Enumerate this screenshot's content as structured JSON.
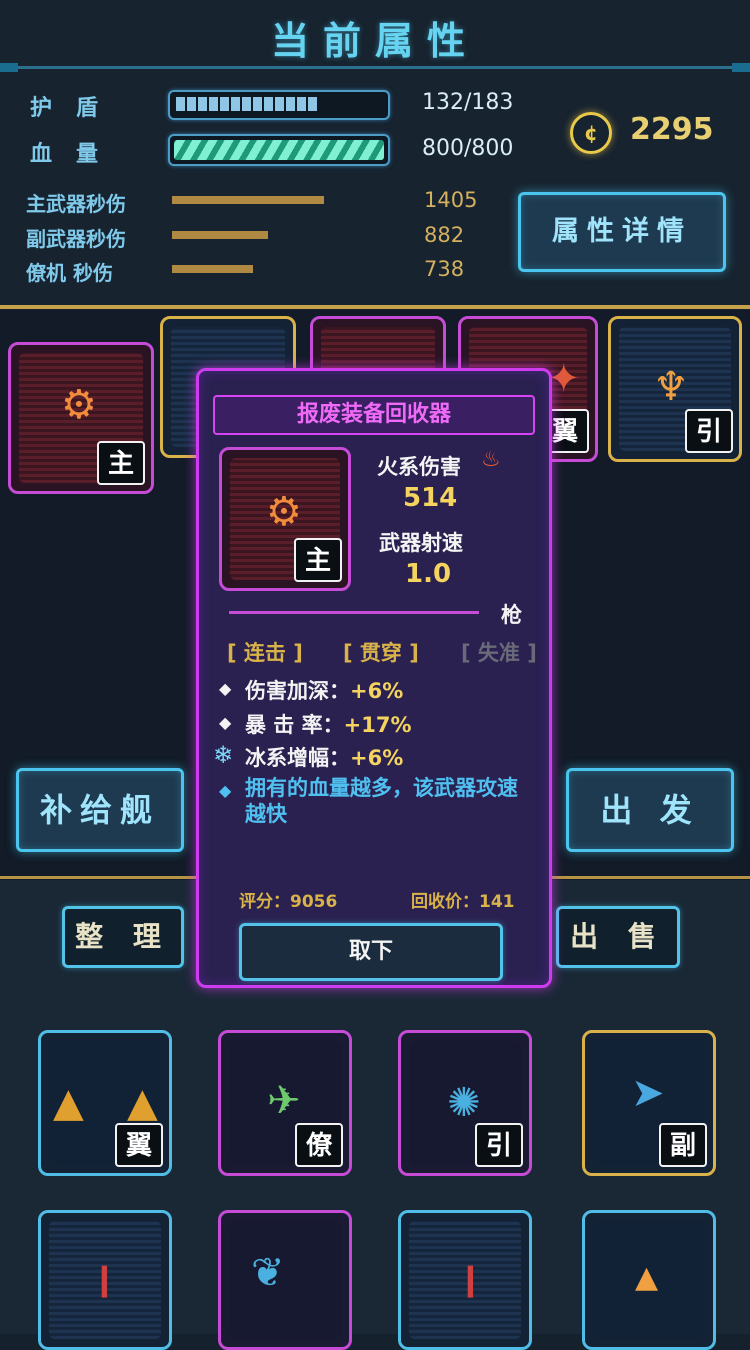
{
  "header": {
    "title": "当前属性"
  },
  "stats": {
    "shield": {
      "label": "护　盾",
      "value": "132/183"
    },
    "hp": {
      "label": "血　量",
      "value": "800/800"
    }
  },
  "dps": [
    {
      "label": "主武器秒伤",
      "value": "1405",
      "fraction": 1.0
    },
    {
      "label": "副武器秒伤",
      "value": "882",
      "fraction": 0.63
    },
    {
      "label": "僚机 秒伤",
      "value": "738",
      "fraction": 0.53
    }
  ],
  "currency": {
    "value": "2295",
    "icon": "coin-icon"
  },
  "buttons": {
    "attr_detail": "属性详情",
    "supply": "补给舰",
    "depart": "出 发",
    "sort": "整 理",
    "sell": "出 售"
  },
  "equipped": [
    {
      "tag": "主",
      "border": "#c64bd6"
    },
    {
      "tag": "",
      "border": "#d9b24a"
    },
    {
      "tag": "",
      "border": "#c64bd6"
    },
    {
      "tag": "翼",
      "border": "#c64bd6"
    },
    {
      "tag": "引",
      "border": "#d9b24a"
    }
  ],
  "popup": {
    "title": "报废装备回收器",
    "item_tag": "主",
    "damage_label": "火系伤害",
    "damage_value": "514",
    "rate_label": "武器射速",
    "rate_value": "1.0",
    "weapon_type": "枪",
    "traits": [
      "[ 连击 ]",
      "[ 贯穿 ]",
      "[ 失准 ]"
    ],
    "attrs": [
      {
        "name": "伤害加深：",
        "value": "+6%"
      },
      {
        "name": "暴 击 率：",
        "value": "+17%"
      },
      {
        "name": "冰系增幅：",
        "value": "+6%"
      }
    ],
    "special": "拥有的血量越多，该武器攻速越快",
    "score": "评分：9056",
    "recycle_price": "回收价：141",
    "remove_label": "取下"
  },
  "inventory_row1": [
    {
      "tag": "翼",
      "border": "#4fbde6"
    },
    {
      "tag": "僚",
      "border": "#c64bd6"
    },
    {
      "tag": "引",
      "border": "#c64bd6"
    },
    {
      "tag": "副",
      "border": "#d9b24a"
    }
  ],
  "inventory_row2": [
    {
      "border": "#4fbde6"
    },
    {
      "border": "#c64bd6"
    },
    {
      "border": "#4fbde6"
    },
    {
      "border": "#4fbde6"
    }
  ],
  "colors": {
    "accent": "#4bc4ee",
    "purple": "#cf3cf0",
    "gold": "#d9b24a"
  }
}
